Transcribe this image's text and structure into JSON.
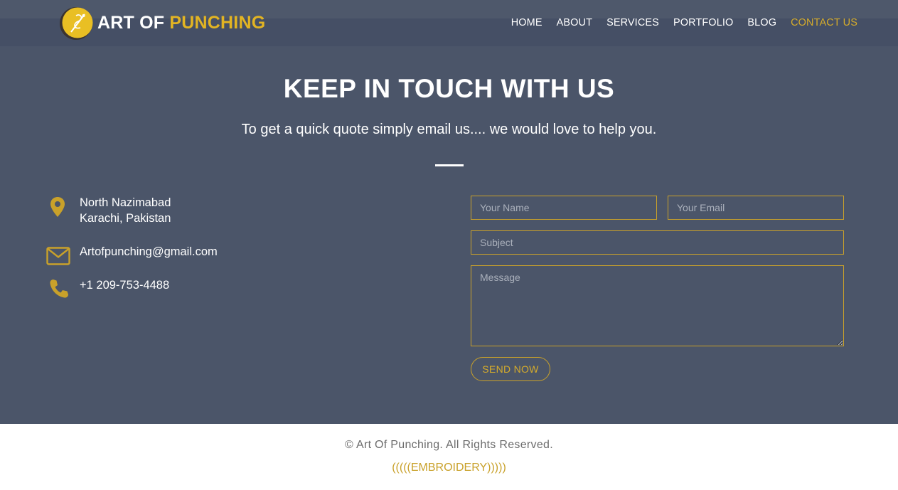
{
  "brand": {
    "word1": "ART OF",
    "word2": "PUNCHING",
    "accent_color": "#e2b423"
  },
  "nav": {
    "items": [
      {
        "label": "HOME"
      },
      {
        "label": "ABOUT"
      },
      {
        "label": "SERVICES"
      },
      {
        "label": "PORTFOLIO"
      },
      {
        "label": "BLOG"
      },
      {
        "label": "CONTACT US",
        "active": true
      }
    ]
  },
  "contact": {
    "heading": "KEEP IN TOUCH WITH US",
    "subheading": "To get a quick quote simply email us.... we would love to help you.",
    "address_line1": "North Nazimabad",
    "address_line2": "Karachi, Pakistan",
    "email": "Artofpunching@gmail.com",
    "phone": "+1 209-753-4488",
    "icons": [
      "location-pin-icon",
      "envelope-icon",
      "phone-icon"
    ]
  },
  "form": {
    "name_placeholder": "Your Name",
    "email_placeholder": "Your Email",
    "subject_placeholder": "Subject",
    "message_placeholder": "Message",
    "send_label": "SEND NOW"
  },
  "footer": {
    "copyright": "© Art Of Punching. All Rights Reserved.",
    "tagline": "(((((EMBROIDERY)))))"
  },
  "colors": {
    "section_bg": "#4b5569",
    "header_bg": "#454f65",
    "gold": "#c9a12a"
  }
}
